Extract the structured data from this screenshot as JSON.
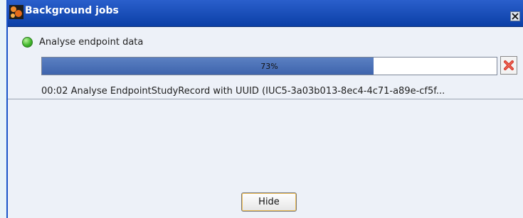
{
  "window": {
    "title": "Background jobs"
  },
  "job": {
    "title": "Analyse endpoint data",
    "progress_percent": 73,
    "progress_label": "73%",
    "detail": "00:02 Analyse EndpointStudyRecord with UUID (IUC5-3a03b013-8ec4-4c71-a89e-cf5f..."
  },
  "footer": {
    "hide_label": "Hide"
  },
  "colors": {
    "titlebar": "#2a5fcc",
    "progress_fill": "#4c72b8",
    "status_ok": "#43b82e",
    "cancel_red": "#d6372a"
  },
  "icons": {
    "app": "app-logo-icon",
    "close": "close-icon",
    "status": "status-green-icon",
    "cancel": "cancel-x-icon"
  }
}
